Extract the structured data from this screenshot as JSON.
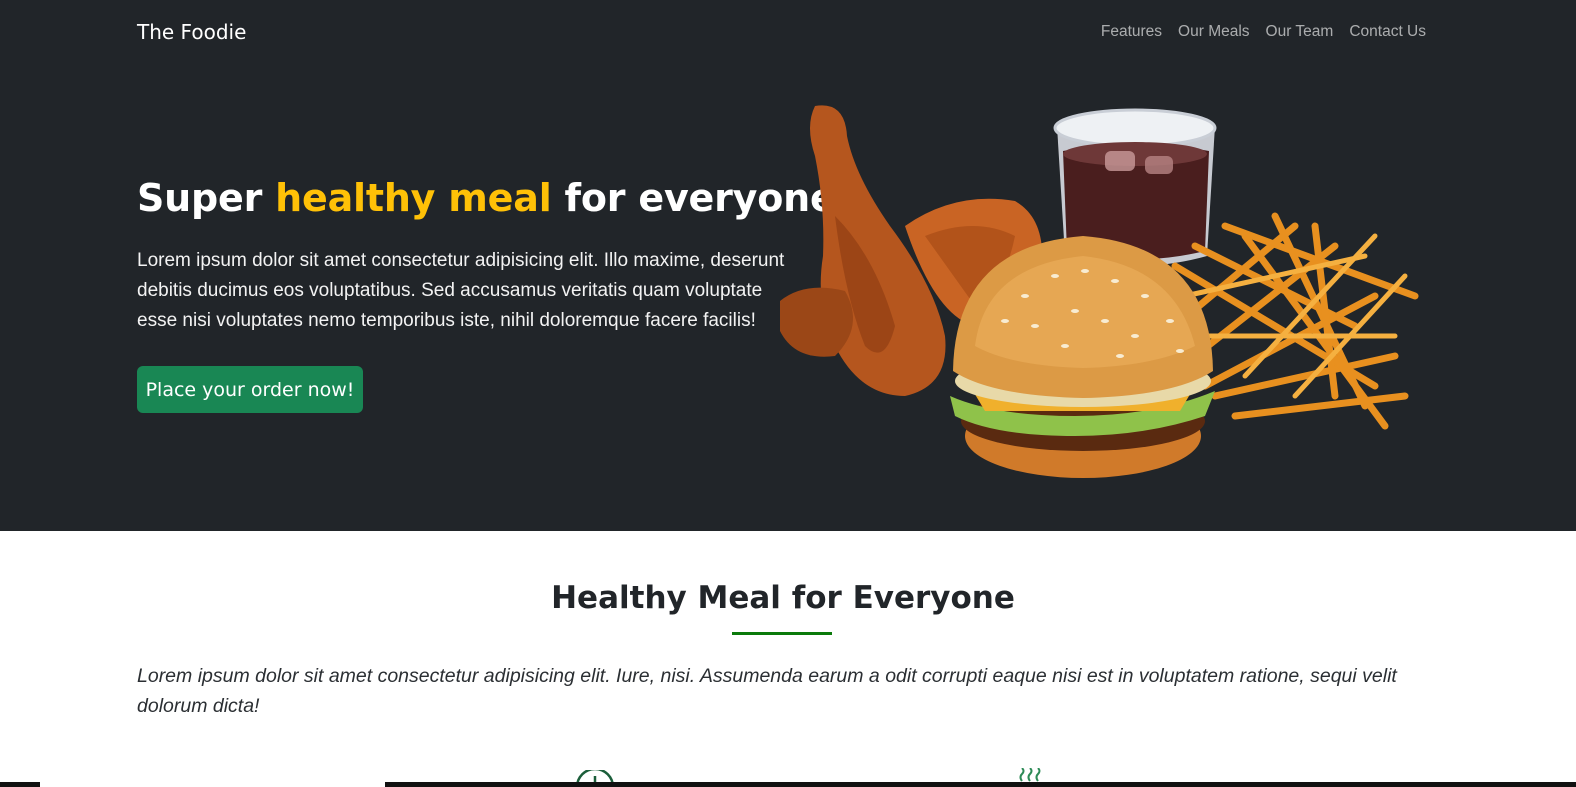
{
  "navbar": {
    "brand": "The Foodie",
    "links": [
      "Features",
      "Our Meals",
      "Our Team",
      "Contact Us"
    ]
  },
  "hero": {
    "title_start": "Super ",
    "title_accent": "healthy meal",
    "title_end": " for everyone",
    "text": "Lorem ipsum dolor sit amet consectetur adipisicing elit. Illo maxime, deserunt debitis ducimus eos voluptatibus. Sed accusamus veritatis quam voluptate esse nisi voluptates nemo temporibus iste, nihil doloremque facere facilis!",
    "cta_label": "Place your order now!",
    "image_icon": "fast-food-meal-image"
  },
  "features": {
    "title": "Healthy Meal for Everyone",
    "text": "Lorem ipsum dolor sit amet consectetur adipisicing elit. Iure, nisi. Assumenda earum a odit corrupti eaque nisi est in voluptatem ratione, sequi velit dolorum dicta!",
    "icons": [
      "clock-icon",
      "steam-icon"
    ]
  },
  "colors": {
    "dark_bg": "#212529",
    "accent_yellow": "#ffc107",
    "button_green": "#198754",
    "divider_green": "#0b7a0b"
  }
}
